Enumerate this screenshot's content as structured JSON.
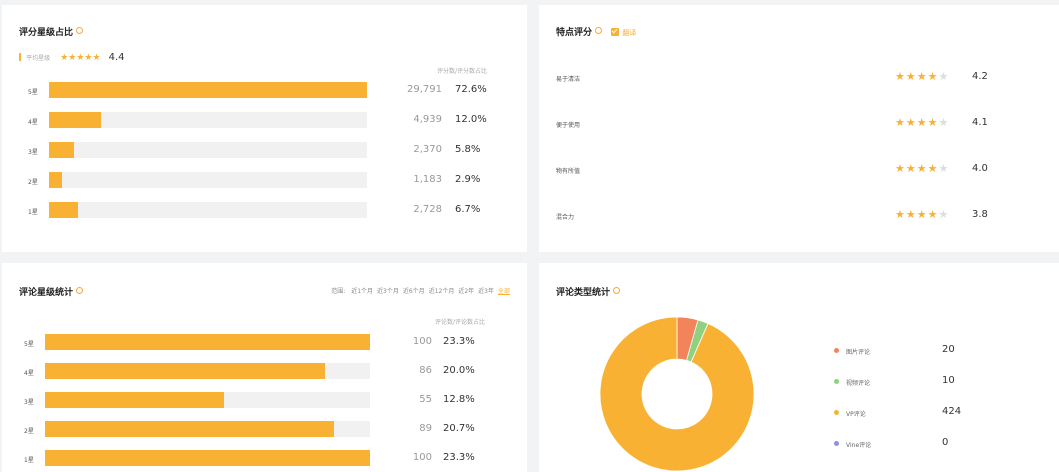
{
  "panel1": {
    "title": "评分星级占比",
    "avg_label": "平均星级",
    "avg_value": "4.4",
    "col_header": "评分数/评分数占比",
    "rows": [
      {
        "label": "5星",
        "count": "29,791",
        "pct": "72.6%",
        "fill": 1.0
      },
      {
        "label": "4星",
        "count": "4,939",
        "pct": "12.0%",
        "fill": 0.165
      },
      {
        "label": "3星",
        "count": "2,370",
        "pct": "5.8%",
        "fill": 0.08
      },
      {
        "label": "2星",
        "count": "1,183",
        "pct": "2.9%",
        "fill": 0.04
      },
      {
        "label": "1星",
        "count": "2,728",
        "pct": "6.7%",
        "fill": 0.092
      }
    ]
  },
  "panel2": {
    "title": "特点评分",
    "toggle_label": "翻译",
    "features": [
      {
        "label": "易于清洁",
        "value": "4.2",
        "stars": 4
      },
      {
        "label": "便于使用",
        "value": "4.1",
        "stars": 4
      },
      {
        "label": "物有所值",
        "value": "4.0",
        "stars": 4
      },
      {
        "label": "混合力",
        "value": "3.8",
        "stars": 4
      }
    ]
  },
  "panel3": {
    "title": "评论星级统计",
    "range_label": "范围:",
    "range_options": [
      "近1个月",
      "近3个月",
      "近6个月",
      "近12个月",
      "近2年",
      "近3年",
      "全部"
    ],
    "active_range": "全部",
    "col_header": "评论数/评论数占比",
    "rows": [
      {
        "label": "5星",
        "count": "100",
        "pct": "23.3%",
        "fill": 1.0
      },
      {
        "label": "4星",
        "count": "86",
        "pct": "20.0%",
        "fill": 0.86
      },
      {
        "label": "3星",
        "count": "55",
        "pct": "12.8%",
        "fill": 0.55
      },
      {
        "label": "2星",
        "count": "89",
        "pct": "20.7%",
        "fill": 0.89
      },
      {
        "label": "1星",
        "count": "100",
        "pct": "23.3%",
        "fill": 1.0
      }
    ]
  },
  "panel4": {
    "title": "评论类型统计"
  },
  "colors": {
    "accent": "#f8b133",
    "photo": "#f2845c",
    "video": "#8fd17e",
    "vp": "#f8b133",
    "vine": "#8c8fe6"
  },
  "chart_data": {
    "type": "pie",
    "categories": [
      "图片评论",
      "视频评论",
      "VP评论",
      "Vine评论"
    ],
    "values": [
      20,
      10,
      424,
      0
    ],
    "colors": [
      "#f2845c",
      "#8fd17e",
      "#f8b133",
      "#8c8fe6"
    ],
    "donut": true,
    "legend": "right"
  }
}
